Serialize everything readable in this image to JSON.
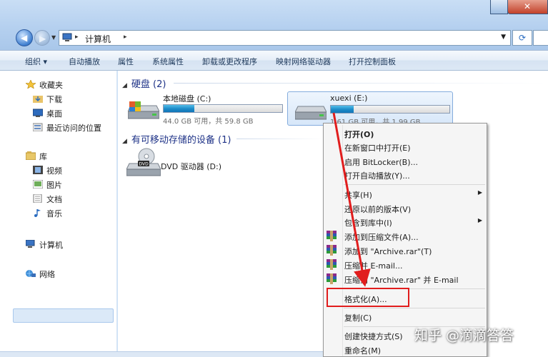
{
  "address": {
    "crumb": "计算机"
  },
  "toolbar": [
    {
      "label": "组织 ▾"
    },
    {
      "label": "自动播放"
    },
    {
      "label": "属性"
    },
    {
      "label": "系统属性"
    },
    {
      "label": "卸载或更改程序"
    },
    {
      "label": "映射网络驱动器"
    },
    {
      "label": "打开控制面板"
    }
  ],
  "nav": {
    "favorites": "收藏夹",
    "downloads": "下载",
    "desktop": "桌面",
    "recent": "最近访问的位置",
    "libraries": "库",
    "videos": "视频",
    "pictures": "图片",
    "documents": "文档",
    "music": "音乐",
    "computer": "计算机",
    "network": "网络"
  },
  "groups": {
    "hdd": "硬盘 (2)",
    "removable": "有可移动存储的设备 (1)"
  },
  "drives": [
    {
      "name": "本地磁盘 (C:)",
      "info": "44.0 GB 可用，共 59.8 GB",
      "used_fraction": 0.26
    },
    {
      "name": "xuexi (E:)",
      "info": "1.61 GB 可用，共 1.99 GB",
      "used_fraction": 0.19
    }
  ],
  "dvd": {
    "name": "DVD 驱动器 (D:)"
  },
  "context_menu": {
    "open": "打开(O)",
    "open_new": "在新窗口中打开(E)",
    "bitlocker": "启用 BitLocker(B)...",
    "autoplay": "打开自动播放(Y)...",
    "share": "共享(H)",
    "restore": "还原以前的版本(V)",
    "library": "包含到库中(I)",
    "add_archive": "添加到压缩文件(A)...",
    "add_rar": "添加到 \"Archive.rar\"(T)",
    "zip_email": "压缩并 E-mail...",
    "zip_rar_email": "压缩到 \"Archive.rar\" 并 E-mail",
    "format": "格式化(A)...",
    "copy": "复制(C)",
    "shortcut": "创建快捷方式(S)",
    "rename": "重命名(M)"
  },
  "watermark": "知乎 @滴滴答答",
  "colors": {
    "highlight": "#e11d1d",
    "progress": "#1c8ac8",
    "selection": "#d7e7f9"
  }
}
